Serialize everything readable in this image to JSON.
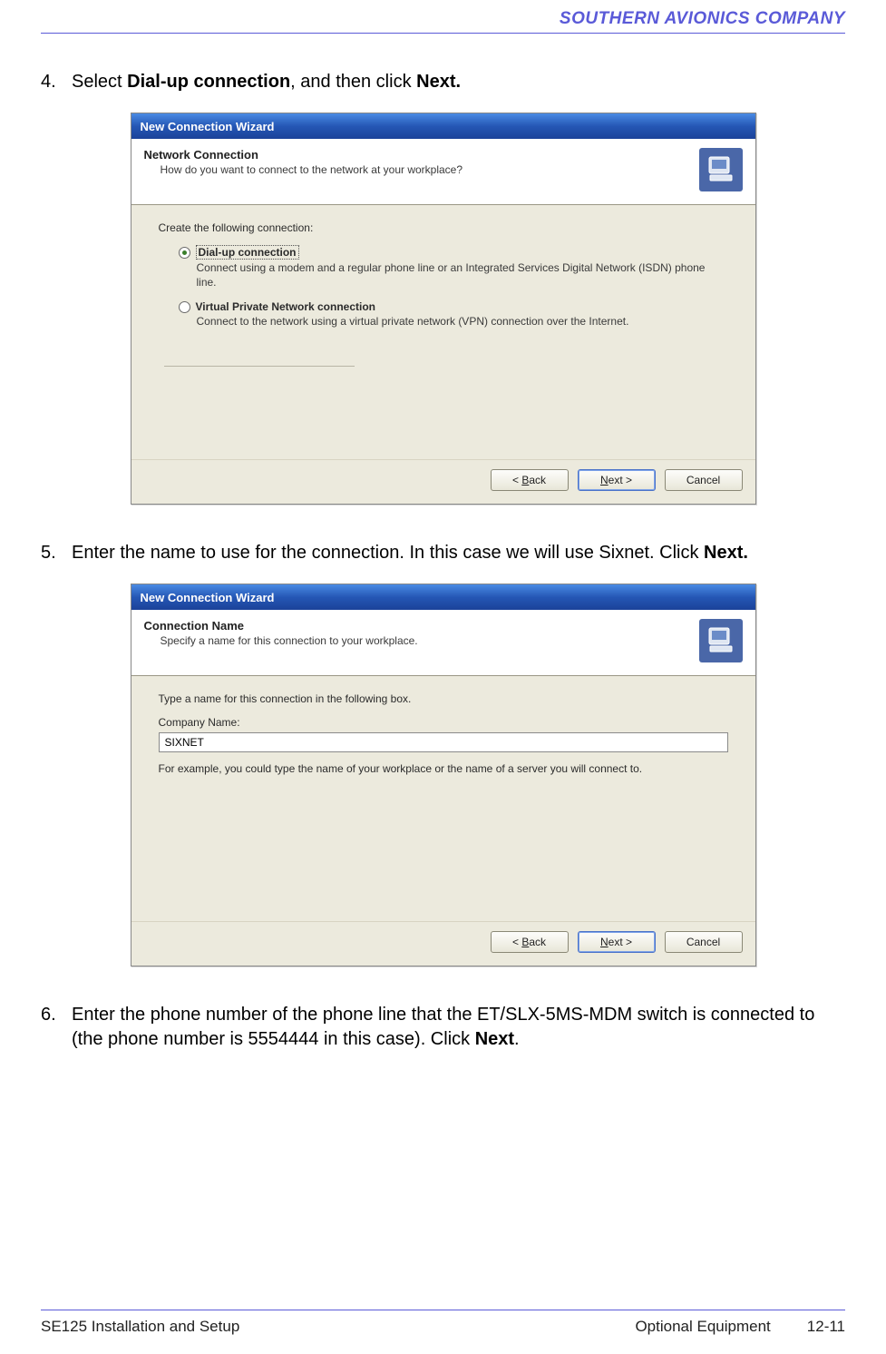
{
  "header": {
    "company": "SOUTHERN AVIONICS COMPANY"
  },
  "steps": {
    "s4": {
      "num": "4.",
      "pre": "Select ",
      "bold1": "Dial-up connection",
      "mid": ", and then click ",
      "bold2": "Next."
    },
    "s5": {
      "num": "5.",
      "pre": "Enter the name to use for the connection.  In this case we will use Sixnet.  Click ",
      "bold1": "Next."
    },
    "s6": {
      "num": "6.",
      "pre": "Enter the phone number of the phone line that the ET/SLX-5MS-MDM switch is connected to (the phone number is 5554444 in this case). Click ",
      "bold1": "Next",
      "post": "."
    }
  },
  "wizard1": {
    "title": "New Connection Wizard",
    "header_title": "Network Connection",
    "header_sub": "How do you want to connect to the network at your workplace?",
    "intro": "Create the following connection:",
    "opt1": {
      "label": "Dial-up connection",
      "desc": "Connect using a modem and a regular phone line or an Integrated Services Digital Network (ISDN) phone line."
    },
    "opt2": {
      "label": "Virtual Private Network connection",
      "desc": "Connect to the network using a virtual private network (VPN) connection over the Internet."
    },
    "buttons": {
      "back": "< Back",
      "next": "Next >",
      "cancel": "Cancel"
    }
  },
  "wizard2": {
    "title": "New Connection Wizard",
    "header_title": "Connection Name",
    "header_sub": "Specify a name for this connection to your workplace.",
    "intro": "Type a name for this connection in the following box.",
    "field_label": "Company Name:",
    "field_value": "SIXNET",
    "hint": "For example, you could type the name of your workplace or the name of a server you will connect to.",
    "buttons": {
      "back": "< Back",
      "next": "Next >",
      "cancel": "Cancel"
    }
  },
  "footer": {
    "left": "SE125 Installation and Setup",
    "center": "Optional Equipment",
    "right": "12-11"
  }
}
